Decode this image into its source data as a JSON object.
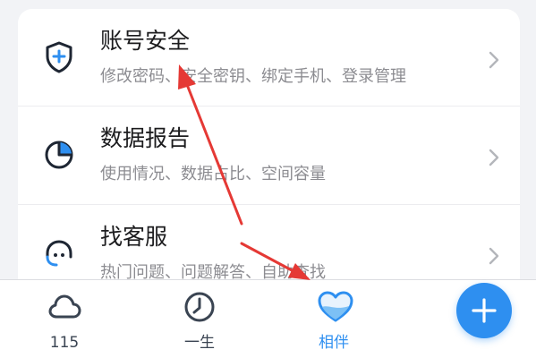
{
  "menu": {
    "items": [
      {
        "title": "账号安全",
        "subtitle": "修改密码、安全密钥、绑定手机、登录管理",
        "icon": "shield-plus-icon"
      },
      {
        "title": "数据报告",
        "subtitle": "使用情况、数据占比、空间容量",
        "icon": "pie-chart-icon"
      },
      {
        "title": "找客服",
        "subtitle": "热门问题、问题解答、自助查找",
        "icon": "headset-icon"
      }
    ],
    "chevron_icon": "chevron-right-icon"
  },
  "tabbar": {
    "tabs": [
      {
        "label": "115",
        "icon": "cloud-icon",
        "active": false
      },
      {
        "label": "一生",
        "icon": "clock-icon",
        "active": false
      },
      {
        "label": "相伴",
        "icon": "heart-icon",
        "active": true
      }
    ],
    "fab_icon": "plus-icon"
  },
  "colors": {
    "accent": "#2e8ff0",
    "annotation_arrow": "#e53935",
    "text_primary": "#1c1c1e",
    "text_secondary": "#8c8c91"
  }
}
